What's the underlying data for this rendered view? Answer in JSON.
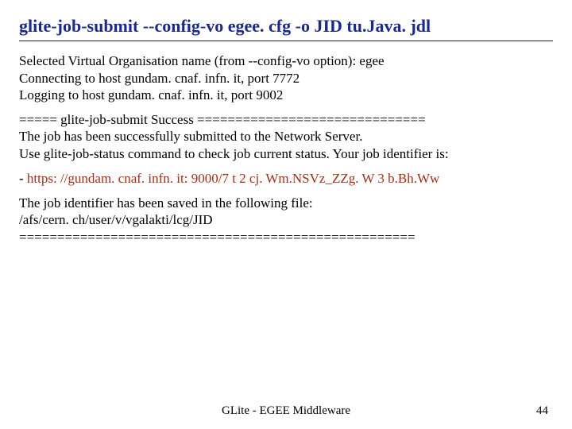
{
  "title": "glite-job-submit --config-vo egee. cfg -o JID tu.Java. jdl",
  "body": {
    "p1_l1": "Selected Virtual Organisation name (from --config-vo option): egee",
    "p1_l2": "Connecting to host gundam. cnaf. infn. it, port 7772",
    "p1_l3": "Logging to host gundam. cnaf. infn. it, port 9002",
    "p2_l1": "===== glite-job-submit Success ==============================",
    "p2_l2": "The job has been successfully submitted to the Network Server.",
    "p2_l3": "Use glite-job-status command to check job current status. Your job identifier is:",
    "url_prefix": " - ",
    "url": "https: //gundam. cnaf. infn. it: 9000/7 t 2 cj. Wm.NSVz_ZZg. W 3 b.Bh.Ww",
    "p3_l1": "The job identifier has been saved in the following file:",
    "p3_l2": "/afs/cern. ch/user/v/vgalakti/lcg/JID",
    "p3_l3": "===================================================="
  },
  "footer": {
    "center": "GLite - EGEE Middleware",
    "page": "44"
  }
}
